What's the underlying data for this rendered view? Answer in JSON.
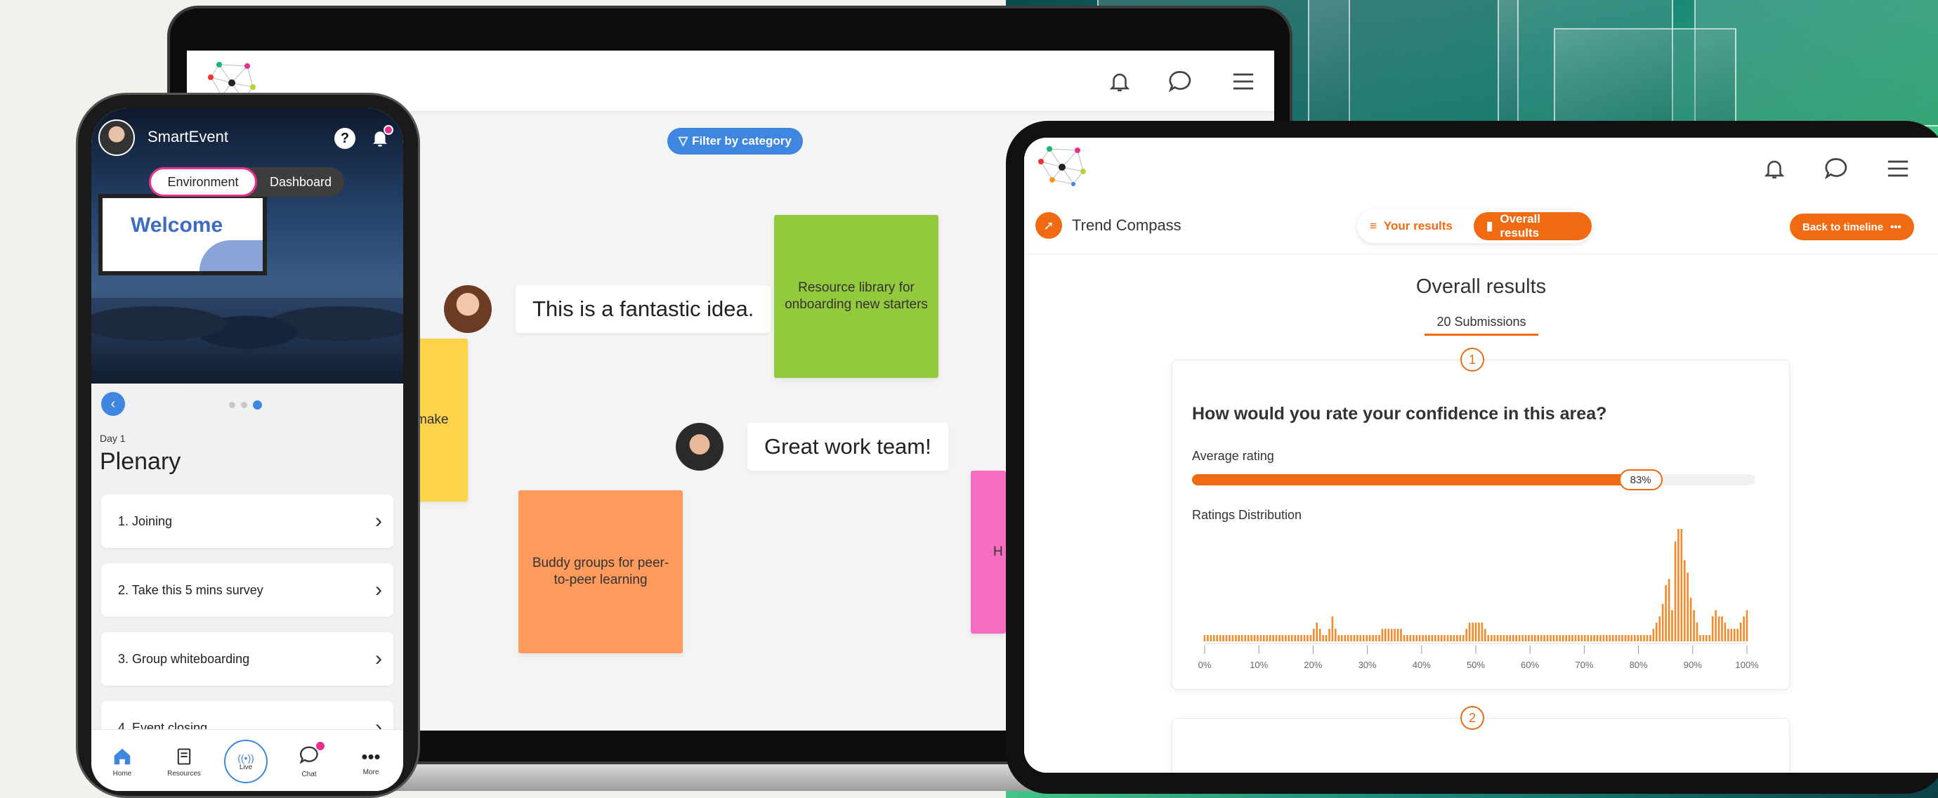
{
  "whiteboard": {
    "filter_label": "Filter by category",
    "notes": [
      {
        "text": "Resource library for onboarding new starters",
        "color": "#93c93c"
      },
      {
        "text": "Buddy groups for peer-to-peer learning",
        "color": "#fd9a5c"
      },
      {
        "text": "make",
        "color": "#fcd34a"
      },
      {
        "text": "H",
        "color": "#f56cc1"
      }
    ],
    "comments": [
      {
        "text": "This is a fantastic idea."
      },
      {
        "text": "Great work team!"
      }
    ]
  },
  "tablet": {
    "module_title": "Trend Compass",
    "tab_your": "Your results",
    "tab_overall": "Overall results",
    "back_label": "Back to timeline",
    "page_title": "Overall results",
    "submissions": "20 Submissions",
    "q1": {
      "number": "1",
      "question": "How would you rate your confidence in this area?",
      "avg_label": "Average rating",
      "avg_value": "83%",
      "avg_fraction": 0.83,
      "dist_label": "Ratings Distribution"
    },
    "q2": {
      "number": "2"
    }
  },
  "phone": {
    "app_name": "SmartEvent",
    "tab_environment": "Environment",
    "tab_dashboard": "Dashboard",
    "hero_sign": "Welcome",
    "day": "Day 1",
    "title": "Plenary",
    "items": [
      {
        "label": "1. Joining"
      },
      {
        "label": "2. Take this 5 mins survey"
      },
      {
        "label": "3. Group whiteboarding"
      },
      {
        "label": "4. Event closing"
      }
    ],
    "nav": {
      "home": "Home",
      "resources": "Resources",
      "live": "Live",
      "chat": "Chat",
      "more": "More"
    }
  },
  "colors": {
    "accent": "#f06a12",
    "blue": "#3e86e0",
    "pink": "#e8318c"
  },
  "chart_data": {
    "type": "bar",
    "title": "Ratings Distribution",
    "x_ticks": [
      "0%",
      "10%",
      "20%",
      "30%",
      "40%",
      "50%",
      "60%",
      "70%",
      "80%",
      "90%",
      "100%"
    ],
    "values": [
      1,
      1,
      1,
      1,
      1,
      1,
      1,
      1,
      1,
      1,
      1,
      1,
      1,
      1,
      1,
      1,
      1,
      1,
      1,
      1,
      1,
      1,
      1,
      1,
      1,
      1,
      1,
      1,
      1,
      1,
      1,
      1,
      1,
      1,
      1,
      2,
      3,
      2,
      1,
      1,
      2,
      4,
      2,
      1,
      1,
      1,
      1,
      1,
      1,
      1,
      1,
      1,
      1,
      1,
      1,
      1,
      1,
      2,
      2,
      2,
      2,
      2,
      2,
      2,
      1,
      1,
      1,
      1,
      1,
      1,
      1,
      1,
      1,
      1,
      1,
      1,
      1,
      1,
      1,
      1,
      1,
      1,
      1,
      1,
      2,
      3,
      3,
      3,
      3,
      3,
      2,
      1,
      1,
      1,
      1,
      1,
      1,
      1,
      1,
      1,
      1,
      1,
      1,
      1,
      1,
      1,
      1,
      1,
      1,
      1,
      1,
      1,
      1,
      1,
      1,
      1,
      1,
      1,
      1,
      1,
      1,
      1,
      1,
      1,
      1,
      1,
      1,
      1,
      1,
      1,
      1,
      1,
      1,
      1,
      1,
      1,
      1,
      1,
      1,
      1,
      1,
      1,
      1,
      1,
      2,
      3,
      4,
      6,
      9,
      10,
      5,
      16,
      18,
      18,
      13,
      11,
      7,
      5,
      3,
      1,
      1,
      1,
      1,
      4,
      5,
      4,
      4,
      3,
      2,
      2,
      2,
      2,
      3,
      4,
      5
    ],
    "ylim": [
      0,
      18
    ]
  }
}
